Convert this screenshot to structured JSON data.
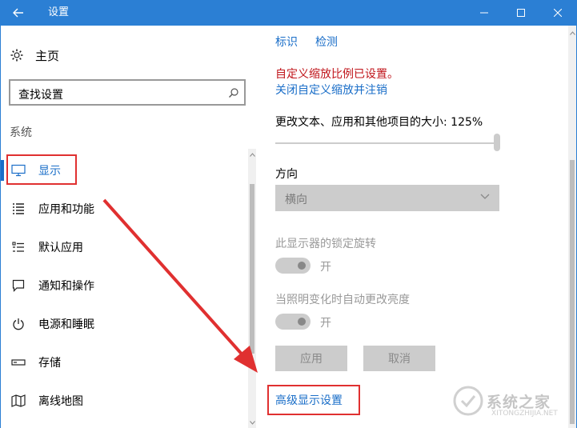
{
  "window": {
    "title": "设置",
    "accent": "#2b7fd4"
  },
  "sidebar": {
    "home_label": "主页",
    "search_placeholder": "查找设置",
    "section_label": "系统",
    "items": [
      {
        "label": "显示",
        "icon": "monitor-icon",
        "active": true
      },
      {
        "label": "应用和功能",
        "icon": "apps-list-icon"
      },
      {
        "label": "默认应用",
        "icon": "default-apps-icon"
      },
      {
        "label": "通知和操作",
        "icon": "notification-icon"
      },
      {
        "label": "电源和睡眠",
        "icon": "power-icon"
      },
      {
        "label": "存储",
        "icon": "storage-icon"
      },
      {
        "label": "离线地图",
        "icon": "map-icon"
      }
    ]
  },
  "display": {
    "identify_link": "标识",
    "detect_link": "检测",
    "custom_scale_warning": "自定义缩放比例已设置。",
    "signout_link": "关闭自定义缩放并注销",
    "scale_label": "更改文本、应用和其他项目的大小: 125%",
    "scale_value": 1.0,
    "orientation_label": "方向",
    "orientation_value": "横向",
    "rotation_lock_label": "此显示器的锁定旋转",
    "rotation_lock_state": "开",
    "auto_brightness_label": "当照明变化时自动更改亮度",
    "auto_brightness_state": "开",
    "apply_button": "应用",
    "cancel_button": "取消",
    "advanced_link": "高级显示设置"
  },
  "colors": {
    "link": "#1a6ec8",
    "warning": "#c0151b",
    "annotation": "#e03030"
  },
  "watermark": {
    "text": "系统之家",
    "sub": "XITONGZHIJIA.NET"
  }
}
